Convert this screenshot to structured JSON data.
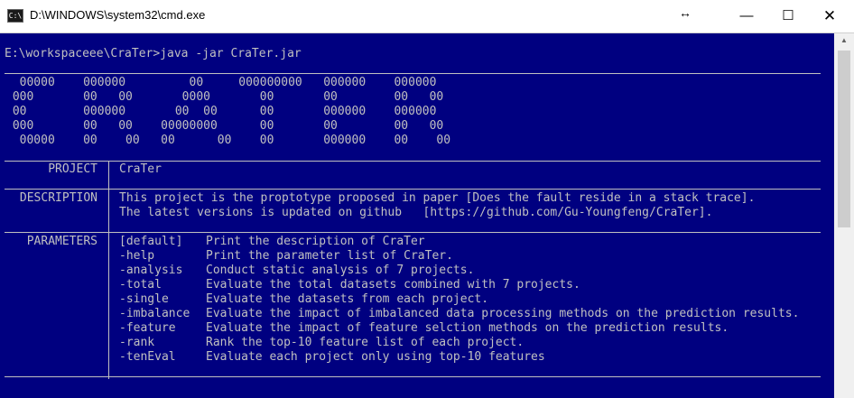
{
  "window": {
    "title": "D:\\WINDOWS\\system32\\cmd.exe",
    "icon": "cmd-icon",
    "resize_hint": "↔",
    "buttons": {
      "minimize": "—",
      "maximize": "☐",
      "close": "✕"
    }
  },
  "console": {
    "prompt": "E:\\workspaceee\\CraTer>java -jar CraTer.jar",
    "banner": [
      "  00000    000000         00     000000000   000000    000000",
      " 000       00   00       0000       00       00        00   00",
      " 00        000000       00  00      00       000000    000000",
      " 000       00   00    00000000      00       00        00   00",
      "  00000    00    00   00      00    00       000000    00    00"
    ],
    "project": {
      "label": "PROJECT",
      "value": "CraTer"
    },
    "description": {
      "label": "DESCRIPTION",
      "lines": [
        "This project is the proptotype proposed in paper [Does the fault reside in a stack trace].",
        "The latest versions is updated on github   [https://github.com/Gu-Youngfeng/CraTer]."
      ]
    },
    "parameters": {
      "label": "PARAMETERS",
      "items": [
        {
          "flag": "[default]",
          "desc": "Print the description of CraTer"
        },
        {
          "flag": "-help",
          "desc": "Print the parameter list of CraTer."
        },
        {
          "flag": "-analysis",
          "desc": "Conduct static analysis of 7 projects."
        },
        {
          "flag": "-total",
          "desc": "Evaluate the total datasets combined with 7 projects."
        },
        {
          "flag": "-single",
          "desc": "Evaluate the datasets from each project."
        },
        {
          "flag": "-imbalance",
          "desc": "Evaluate the impact of imbalanced data processing methods on the prediction results."
        },
        {
          "flag": "-feature",
          "desc": "Evaluate the impact of feature selction methods on the prediction results."
        },
        {
          "flag": "-rank",
          "desc": "Rank the top-10 feature list of each project."
        },
        {
          "flag": "-tenEval",
          "desc": "Evaluate each project only using top-10 features"
        }
      ]
    }
  },
  "colors": {
    "background": "#000080",
    "text": "#c0c0c0",
    "titlebar": "#ffffff"
  }
}
